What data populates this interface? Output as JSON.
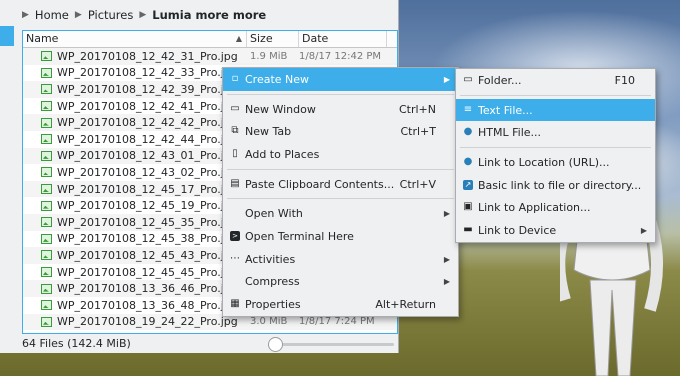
{
  "breadcrumb": {
    "home": "Home",
    "pictures": "Pictures",
    "current": "Lumia more more"
  },
  "columns": {
    "name": "Name",
    "size": "Size",
    "date": "Date"
  },
  "files": [
    {
      "name": "WP_20170108_12_42_31_Pro.jpg",
      "size": "1.9 MiB",
      "date": "1/8/17 12:42 PM"
    },
    {
      "name": "WP_20170108_12_42_33_Pro.jpg",
      "size": "",
      "date": ""
    },
    {
      "name": "WP_20170108_12_42_39_Pro.jpg",
      "size": "",
      "date": ""
    },
    {
      "name": "WP_20170108_12_42_41_Pro.jpg",
      "size": "",
      "date": ""
    },
    {
      "name": "WP_20170108_12_42_42_Pro.jpg",
      "size": "",
      "date": ""
    },
    {
      "name": "WP_20170108_12_42_44_Pro.jpg",
      "size": "",
      "date": ""
    },
    {
      "name": "WP_20170108_12_43_01_Pro.jpg",
      "size": "",
      "date": ""
    },
    {
      "name": "WP_20170108_12_43_02_Pro.jpg",
      "size": "",
      "date": ""
    },
    {
      "name": "WP_20170108_12_45_17_Pro.jpg",
      "size": "",
      "date": ""
    },
    {
      "name": "WP_20170108_12_45_19_Pro.jpg",
      "size": "",
      "date": ""
    },
    {
      "name": "WP_20170108_12_45_35_Pro.jpg",
      "size": "",
      "date": ""
    },
    {
      "name": "WP_20170108_12_45_38_Pro.jpg",
      "size": "",
      "date": ""
    },
    {
      "name": "WP_20170108_12_45_43_Pro.jpg",
      "size": "",
      "date": ""
    },
    {
      "name": "WP_20170108_12_45_45_Pro.jpg",
      "size": "",
      "date": ""
    },
    {
      "name": "WP_20170108_13_36_46_Pro.jpg",
      "size": "",
      "date": ""
    },
    {
      "name": "WP_20170108_13_36_48_Pro.jpg",
      "size": "",
      "date": ""
    },
    {
      "name": "WP_20170108_19_24_22_Pro.jpg",
      "size": "3.0 MiB",
      "date": "1/8/17 7:24 PM"
    }
  ],
  "status": {
    "text": "64 Files (142.4 MiB)"
  },
  "context_menu": {
    "create_new": "Create New",
    "new_window": "New Window",
    "new_window_sc": "Ctrl+N",
    "new_tab": "New Tab",
    "new_tab_sc": "Ctrl+T",
    "add_to_places": "Add to Places",
    "paste": "Paste Clipboard Contents...",
    "paste_sc": "Ctrl+V",
    "open_with": "Open With",
    "open_terminal": "Open Terminal Here",
    "activities": "Activities",
    "compress": "Compress",
    "properties": "Properties",
    "properties_sc": "Alt+Return"
  },
  "submenu": {
    "folder": "Folder...",
    "folder_sc": "F10",
    "text_file": "Text File...",
    "html_file": "HTML File...",
    "link_location": "Link to Location (URL)...",
    "basic_link": "Basic link to file or directory...",
    "link_application": "Link to Application...",
    "link_device": "Link to Device"
  },
  "colors": {
    "highlight": "#3daee9",
    "window": "#eff0f1"
  }
}
